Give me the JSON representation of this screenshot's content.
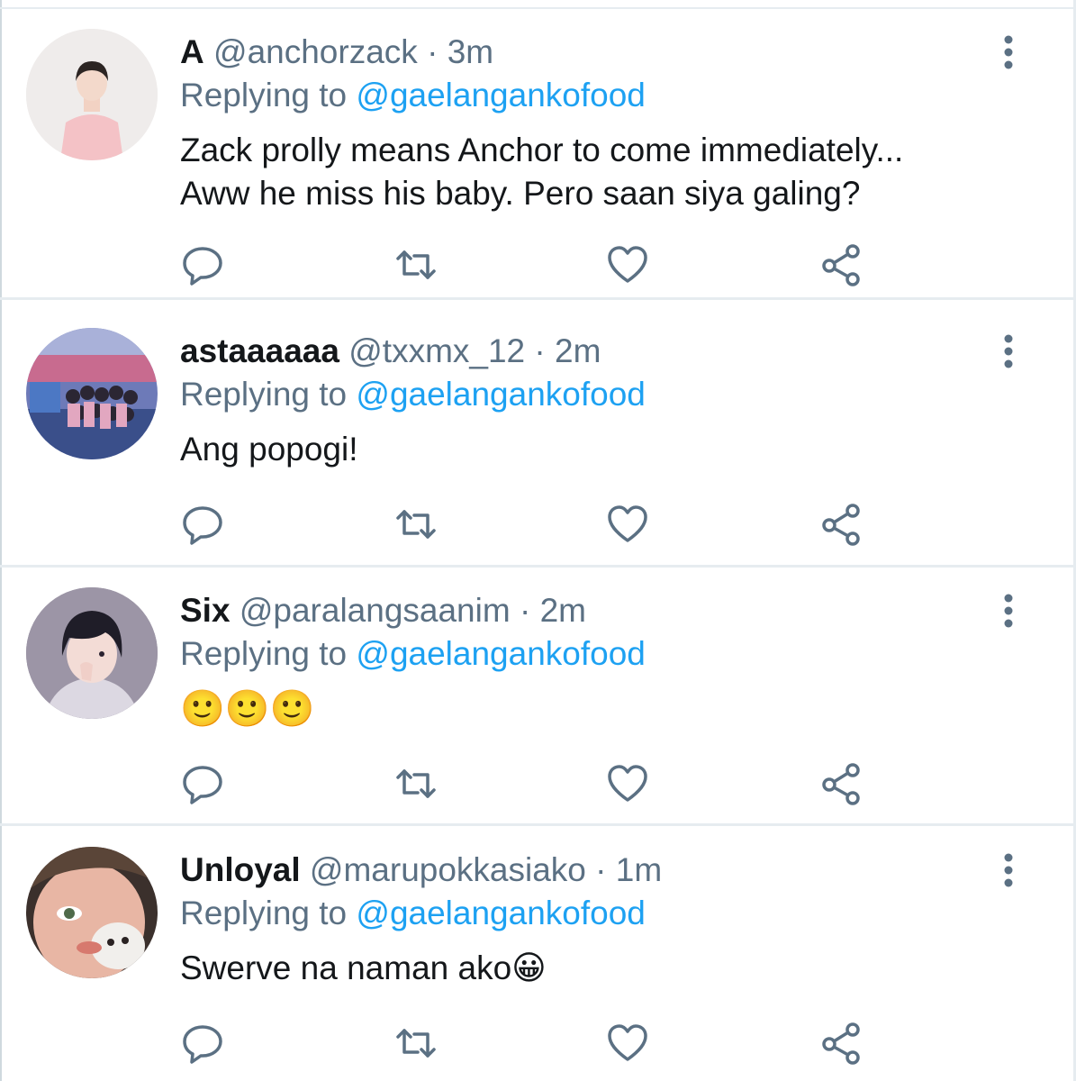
{
  "tweets": [
    {
      "name": "A",
      "handle": "@anchorzack",
      "time": "3m",
      "replying_label": "Replying to",
      "replying_to": "@gaelangankofood",
      "text_lines": [
        "Zack prolly means Anchor to come immediately...",
        "Aww he miss his baby. Pero saan siya galing?"
      ],
      "emoji": ""
    },
    {
      "name": "astaaaaaa",
      "handle": "@txxmx_12",
      "time": "2m",
      "replying_label": "Replying to",
      "replying_to": "@gaelangankofood",
      "text_lines": [
        "Ang popogi!"
      ],
      "emoji": ""
    },
    {
      "name": "Six",
      "handle": "@paralangsaanim",
      "time": "2m",
      "replying_label": "Replying to",
      "replying_to": "@gaelangankofood",
      "text_lines": [],
      "emoji": "🙂🙂🙂"
    },
    {
      "name": "Unloyal",
      "handle": "@marupokkasiako",
      "time": "1m",
      "replying_label": "Replying to",
      "replying_to": "@gaelangankofood",
      "text_lines": [
        "Swerve na naman ako"
      ],
      "emoji": "😀"
    }
  ],
  "separator": "·",
  "icons": {
    "more": "more-vertical-icon",
    "reply": "reply-bubble-icon",
    "retweet": "retweet-icon",
    "like": "heart-icon",
    "share": "share-icon"
  },
  "colors": {
    "text": "#14171a",
    "secondary": "#5b7083",
    "link": "#1da1f2",
    "divider": "#e6ecf0"
  }
}
